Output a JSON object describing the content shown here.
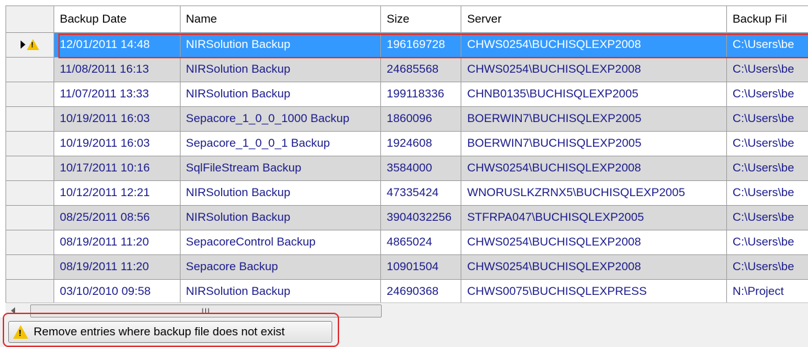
{
  "columns": [
    "Backup Date",
    "Name",
    "Size",
    "Server",
    "Backup Fil"
  ],
  "rows": [
    [
      "12/01/2011 14:48",
      "NIRSolution Backup",
      "196169728",
      "CHWS0254\\BUCHISQLEXP2008",
      "C:\\Users\\be"
    ],
    [
      "11/08/2011 16:13",
      "NIRSolution Backup",
      "24685568",
      "CHWS0254\\BUCHISQLEXP2008",
      "C:\\Users\\be"
    ],
    [
      "11/07/2011 13:33",
      "NIRSolution Backup",
      "199118336",
      "CHNB0135\\BUCHISQLEXP2005",
      "C:\\Users\\be"
    ],
    [
      "10/19/2011 16:03",
      "Sepacore_1_0_0_1000 Backup",
      "1860096",
      "BOERWIN7\\BUCHISQLEXP2005",
      "C:\\Users\\be"
    ],
    [
      "10/19/2011 16:03",
      "Sepacore_1_0_0_1 Backup",
      "1924608",
      "BOERWIN7\\BUCHISQLEXP2005",
      "C:\\Users\\be"
    ],
    [
      "10/17/2011 10:16",
      "SqlFileStream Backup",
      "3584000",
      "CHWS0254\\BUCHISQLEXP2008",
      "C:\\Users\\be"
    ],
    [
      "10/12/2011 12:21",
      "NIRSolution Backup",
      "47335424",
      "WNORUSLKZRNX5\\BUCHISQLEXP2005",
      "C:\\Users\\be"
    ],
    [
      "08/25/2011 08:56",
      "NIRSolution Backup",
      "3904032256",
      "STFRPA047\\BUCHISQLEXP2005",
      "C:\\Users\\be"
    ],
    [
      "08/19/2011 11:20",
      "SepacoreControl Backup",
      "4865024",
      "CHWS0254\\BUCHISQLEXP2008",
      "C:\\Users\\be"
    ],
    [
      "08/19/2011 11:20",
      "Sepacore Backup",
      "10901504",
      "CHWS0254\\BUCHISQLEXP2008",
      "C:\\Users\\be"
    ],
    [
      "03/10/2010 09:58",
      "NIRSolution Backup",
      "24690368",
      "CHWS0075\\BUCHISQLEXPRESS",
      "N:\\Project"
    ]
  ],
  "selected_row": 0,
  "scrollbar": {
    "grip": "III"
  },
  "action_button": {
    "label": "Remove entries where backup file does not exist",
    "icon": "warning-icon"
  },
  "colors": {
    "selection": "#3399ff",
    "highlight_outline": "#e03030",
    "alt_row": "#d9d9d9",
    "cell_text": "#1a1a8c"
  }
}
